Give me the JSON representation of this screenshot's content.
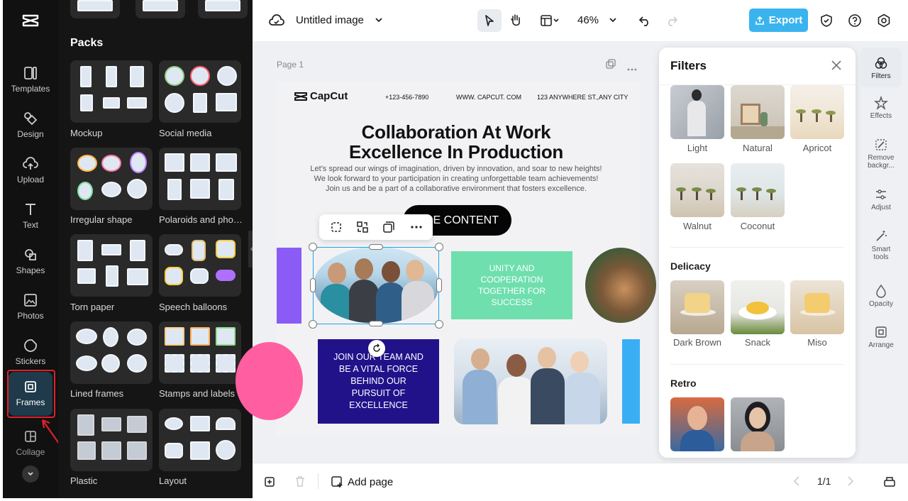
{
  "app": {
    "name": "CapCut",
    "title": "Untitled image",
    "zoom": "46%"
  },
  "rail": {
    "items": [
      {
        "label": "Templates",
        "icon": "templates-icon"
      },
      {
        "label": "Design",
        "icon": "design-icon"
      },
      {
        "label": "Upload",
        "icon": "upload-icon"
      },
      {
        "label": "Text",
        "icon": "text-icon"
      },
      {
        "label": "Shapes",
        "icon": "shapes-icon"
      },
      {
        "label": "Photos",
        "icon": "photos-icon"
      },
      {
        "label": "Stickers",
        "icon": "stickers-icon"
      },
      {
        "label": "Frames",
        "icon": "frames-icon"
      },
      {
        "label": "Collage",
        "icon": "collage-icon"
      }
    ]
  },
  "panel": {
    "heading": "Packs",
    "packs": [
      {
        "label": "Mockup"
      },
      {
        "label": "Social media"
      },
      {
        "label": "Irregular shape"
      },
      {
        "label": "Polaroids and photo..."
      },
      {
        "label": "Torn paper"
      },
      {
        "label": "Speech balloons"
      },
      {
        "label": "Lined frames"
      },
      {
        "label": "Stamps and labels"
      },
      {
        "label": "Plastic"
      },
      {
        "label": "Layout"
      }
    ]
  },
  "toolbar": {
    "export_label": "Export"
  },
  "canvas": {
    "page_label": "Page 1",
    "brand": "CapCut",
    "phone": "+123-456-7890",
    "website": "WWW. CAPCUT. COM",
    "address": "123 ANYWHERE ST.,ANY CITY",
    "headline_1": "Collaboration At Work",
    "headline_2": "Excellence In Production",
    "body_1": "Let's spread our wings of imagination, driven by innovation, and soar to new heights!",
    "body_2": "We look forward to your participation in creating unforgettable team achievements!",
    "body_3": "Join us and be a part of a collaborative environment that fosters excellence.",
    "cta": "RE CONTENT",
    "green_box": "UNITY AND COOPERATION TOGETHER FOR SUCCESS",
    "blue_box": "JOIN OUR TEAM AND BE A VITAL FORCE BEHIND OUR PURSUIT OF EXCELLENCE"
  },
  "bottom": {
    "add_page": "Add page",
    "page_count": "1/1"
  },
  "filters": {
    "title": "Filters",
    "top_items": [
      "Light",
      "Natural",
      "Apricot",
      "Walnut",
      "Coconut"
    ],
    "sections": [
      {
        "title": "Delicacy",
        "items": [
          "Dark Brown",
          "Snack",
          "Miso"
        ]
      },
      {
        "title": "Retro",
        "items": []
      }
    ]
  },
  "right_rail": {
    "items": [
      "Filters",
      "Effects",
      "Remove backgr...",
      "Adjust",
      "Smart tools",
      "Opacity",
      "Arrange"
    ]
  },
  "colors": {
    "accent": "#1fa4e6",
    "green_box": "#6fdfae",
    "blue_box": "#22128a",
    "purple": "#8a5cf5",
    "pink": "#ff5fa0"
  }
}
